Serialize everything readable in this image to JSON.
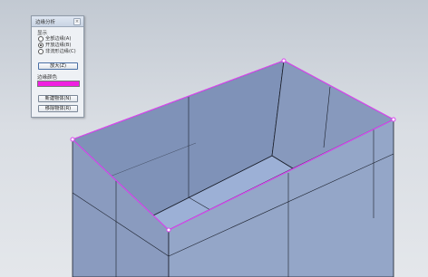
{
  "panel": {
    "title": "边缘分析",
    "close_glyph": "×",
    "display_label": "显示",
    "options": [
      {
        "label": "全部边缘(A)",
        "checked": false
      },
      {
        "label": "开放边缘(B)",
        "checked": true
      },
      {
        "label": "非流形边缘(C)",
        "checked": false
      }
    ],
    "zoom_button": "放大(Z)",
    "edge_color_label": "边缘颜色",
    "edge_color": "#f020e0",
    "create_button": "新建物体(N)",
    "remove_button": "移除物体(R)"
  },
  "colors": {
    "box_face": "#8d9fc2",
    "box_edge": "#1a1f2b",
    "highlight_edge": "#d946ef"
  }
}
